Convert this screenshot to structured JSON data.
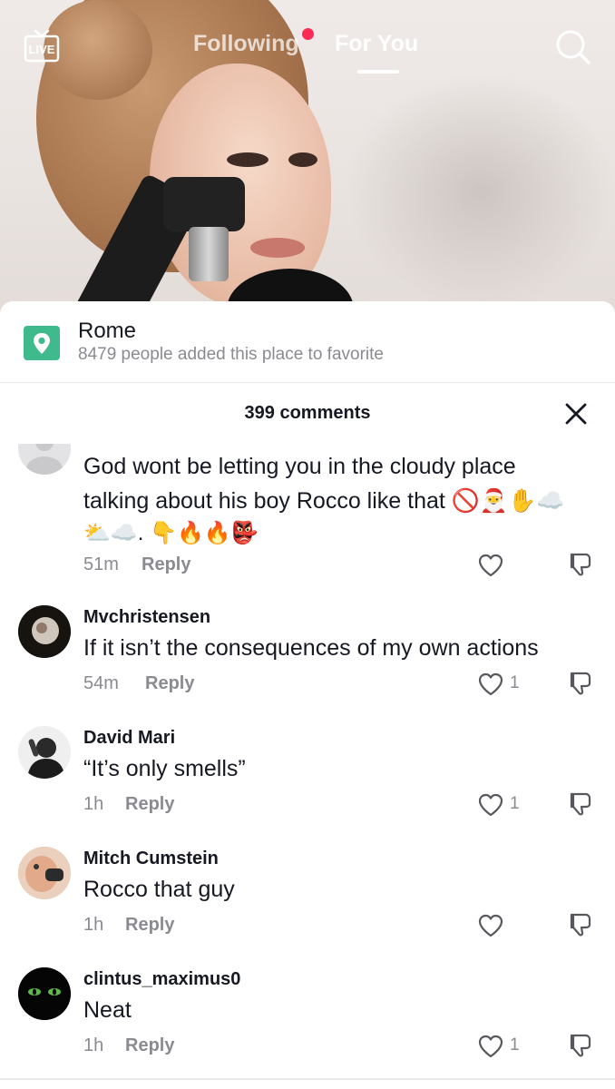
{
  "topbar": {
    "live_label": "LIVE",
    "tab_following": "Following",
    "tab_for_you": "For You",
    "accent": "#fe2c55"
  },
  "place": {
    "name": "Rome",
    "subtitle": "8479 people added this place to favorite",
    "icon": "location-pin-icon",
    "icon_color": "#3fba8c"
  },
  "comments_header": {
    "count_label": "399 comments"
  },
  "comments": [
    {
      "username": "",
      "text": "God wont be letting you in the cloudy place talking about his boy Rocco like that 🚫🎅✋☁️ ⛅☁️. 👇🔥🔥👺",
      "text_line1": "God wont be letting you in the cloudy place",
      "text_line2": "talking about his boy Rocco like that 🚫🎅✋☁️",
      "text_line3": "⛅☁️. 👇🔥🔥👺",
      "time": "51m",
      "reply": "Reply",
      "likes": ""
    },
    {
      "username": "Mvchristensen",
      "text": "If it isn’t the consequences of my own actions",
      "time": "54m",
      "reply": "Reply",
      "likes": "1"
    },
    {
      "username": "David Mari",
      "text": "“It’s only smells”",
      "time": "1h",
      "reply": "Reply",
      "likes": "1"
    },
    {
      "username": "Mitch Cumstein",
      "text": "Rocco that guy",
      "time": "1h",
      "reply": "Reply",
      "likes": ""
    },
    {
      "username": "clintus_maximus0",
      "text": "Neat",
      "time": "1h",
      "reply": "Reply",
      "likes": "1"
    }
  ]
}
